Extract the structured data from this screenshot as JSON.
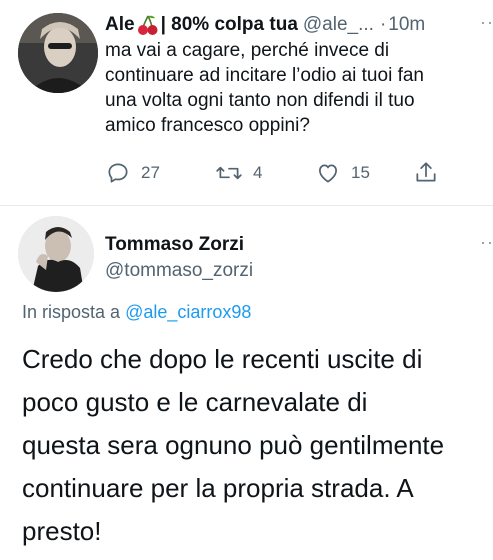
{
  "reply_tweet": {
    "author_name": "Ale",
    "author_name_suffix": "| 80% colpa tua",
    "handle": "@ale_...",
    "separator": "·",
    "time": "10m",
    "text_lines": [
      "ma vai a cagare, perché invece di",
      "continuare ad incitare l’odio ai tuoi fan",
      "una volta ogni tanto non difendi il tuo",
      "amico francesco oppini?"
    ],
    "actions": {
      "replies": "27",
      "retweets": "4",
      "likes": "15"
    }
  },
  "main_tweet": {
    "author_name": "Tommaso Zorzi",
    "handle": "@tommaso_zorzi",
    "in_reply_prefix": "In risposta a",
    "in_reply_handle": "@ale_ciarrox98",
    "text_lines": [
      "Credo che dopo le recenti uscite di",
      "poco gusto e le carnevalate di",
      "questa sera ognuno può gentilmente",
      "continuare per la propria strada. A",
      "presto!"
    ]
  },
  "colors": {
    "link": "#1d9bf0",
    "muted": "#536471",
    "cherry": "#d7263d"
  },
  "icons": [
    "cherry-icon",
    "reply-icon",
    "retweet-icon",
    "like-icon",
    "share-icon",
    "more-icon"
  ]
}
